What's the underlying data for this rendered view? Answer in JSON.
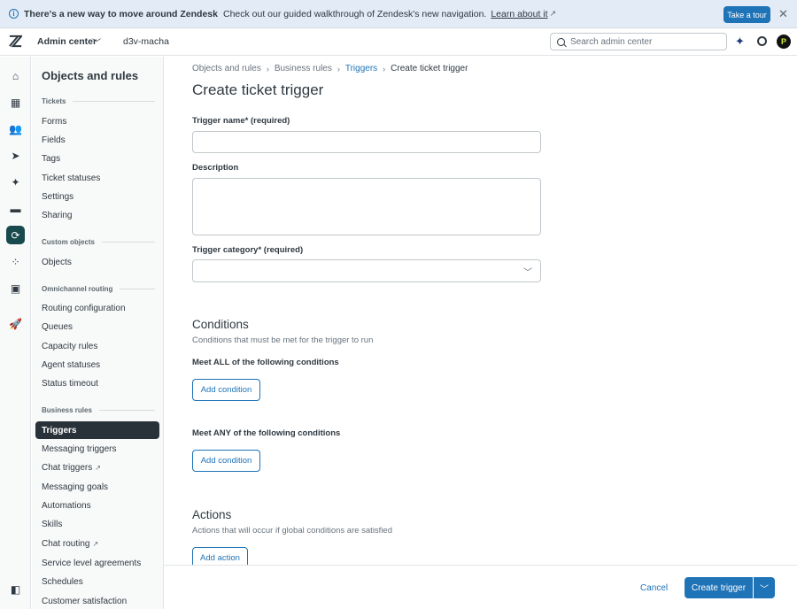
{
  "banner": {
    "title": "There's a new way to move around Zendesk",
    "text": "Check out our guided walkthrough of Zendesk's new navigation.",
    "link": "Learn about it",
    "tour_button": "Take a tour",
    "icon": "info-icon"
  },
  "header": {
    "app_name": "Admin center",
    "instance": "d3v-macha",
    "search_placeholder": "Search admin center",
    "avatar_letter": "P"
  },
  "rail": {
    "icons": [
      "home-icon",
      "building-icon",
      "people-icon",
      "channels-icon",
      "ai-sparkle-icon",
      "workspaces-icon",
      "objects-rules-icon",
      "apps-icon",
      "account-icon",
      "rocket-icon",
      "collapse-sidebar-icon"
    ]
  },
  "nav": {
    "title": "Objects and rules",
    "sections": {
      "tickets": "Tickets",
      "custom_objects": "Custom objects",
      "omnichannel": "Omnichannel routing",
      "business_rules": "Business rules"
    },
    "items": {
      "forms": "Forms",
      "fields": "Fields",
      "tags": "Tags",
      "ticket_statuses": "Ticket statuses",
      "settings": "Settings",
      "sharing": "Sharing",
      "objects": "Objects",
      "routing_configuration": "Routing configuration",
      "queues": "Queues",
      "capacity_rules": "Capacity rules",
      "agent_statuses": "Agent statuses",
      "status_timeout": "Status timeout",
      "triggers": "Triggers",
      "messaging_triggers": "Messaging triggers",
      "chat_triggers": "Chat triggers",
      "messaging_goals": "Messaging goals",
      "automations": "Automations",
      "skills": "Skills",
      "chat_routing": "Chat routing",
      "sla": "Service level agreements",
      "schedules": "Schedules",
      "customer_satisfaction": "Customer satisfaction"
    }
  },
  "breadcrumb": {
    "level1": "Objects and rules",
    "level2": "Business rules",
    "level3": "Triggers",
    "current": "Create ticket trigger"
  },
  "form": {
    "title": "Create ticket trigger",
    "name_label": "Trigger name* (required)",
    "name_value": "",
    "description_label": "Description",
    "description_value": "",
    "category_label": "Trigger category* (required)",
    "category_value": ""
  },
  "conditions": {
    "title": "Conditions",
    "hint": "Conditions that must be met for the trigger to run",
    "all_label": "Meet ALL of the following conditions",
    "any_label": "Meet ANY of the following conditions",
    "add_button": "Add condition"
  },
  "actions": {
    "title": "Actions",
    "hint": "Actions that will occur if global conditions are satisfied",
    "add_button": "Add action"
  },
  "footer": {
    "cancel": "Cancel",
    "create": "Create trigger"
  }
}
